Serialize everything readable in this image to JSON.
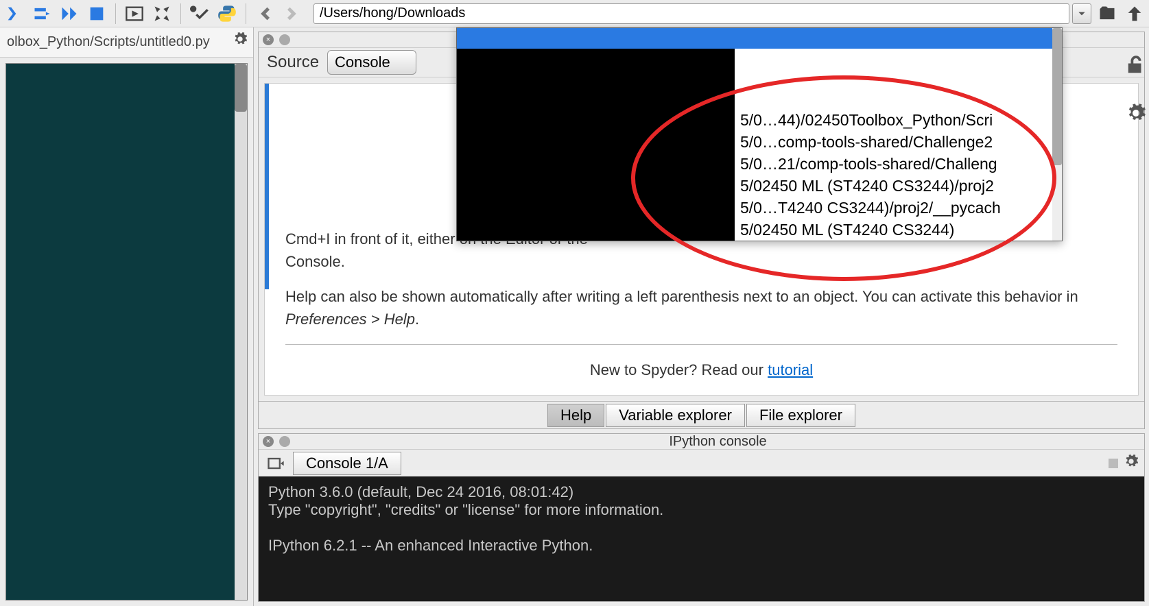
{
  "toolbar": {
    "path_value": "/Users/hong/Downloads"
  },
  "file_tab": "olbox_Python/Scripts/untitled0.py",
  "source_bar": {
    "label": "Source",
    "select": "Console"
  },
  "help_body": {
    "partial_line1": "Cmd+I in front of it, either on the Editor or the",
    "partial_line2": "Console.",
    "para": "Help can also be shown automatically after writing a left parenthesis next to an object. You can activate this behavior in ",
    "pref_path": "Preferences > Help",
    "tutorial_lead": "New to Spyder? Read our ",
    "tutorial_link": "tutorial"
  },
  "pane_tabs": {
    "help": "Help",
    "varexp": "Variable explorer",
    "fileexp": "File explorer"
  },
  "console": {
    "title": "IPython console",
    "tab": "Console 1/A",
    "line1": "Python 3.6.0 (default, Dec 24 2016, 08:01:42) ",
    "line2": "Type \"copyright\", \"credits\" or \"license\" for more information.",
    "line3": "",
    "line4": "IPython 6.2.1 -- An enhanced Interactive Python."
  },
  "dropdown": {
    "items": [
      "5/0…44)/02450Toolbox_Python/Scri",
      "5/0…comp-tools-shared/Challenge2",
      "5/0…21/comp-tools-shared/Challeng",
      "5/02450 ML (ST4240 CS3244)/proj2",
      "5/0…T4240 CS3244)/proj2/__pycach",
      "5/02450 ML (ST4240 CS3244)"
    ]
  }
}
